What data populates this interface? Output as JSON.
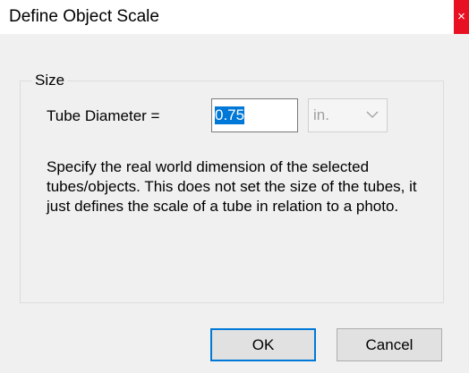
{
  "dialog": {
    "title": "Define Object Scale",
    "close_glyph": "×",
    "close_icon": "close-icon",
    "accent_color": "#0078d7",
    "close_color": "#e81123"
  },
  "size_group": {
    "legend": "Size",
    "diameter_label": "Tube Diameter =",
    "diameter_value": "0.75",
    "unit_value": "in.",
    "unit_icon": "chevron-down-icon",
    "description": "Specify the real world dimension of the selected tubes/objects. This does not set the size of the tubes, it just defines the scale of a tube in relation to a photo."
  },
  "buttons": {
    "ok_label": "OK",
    "cancel_label": "Cancel"
  }
}
